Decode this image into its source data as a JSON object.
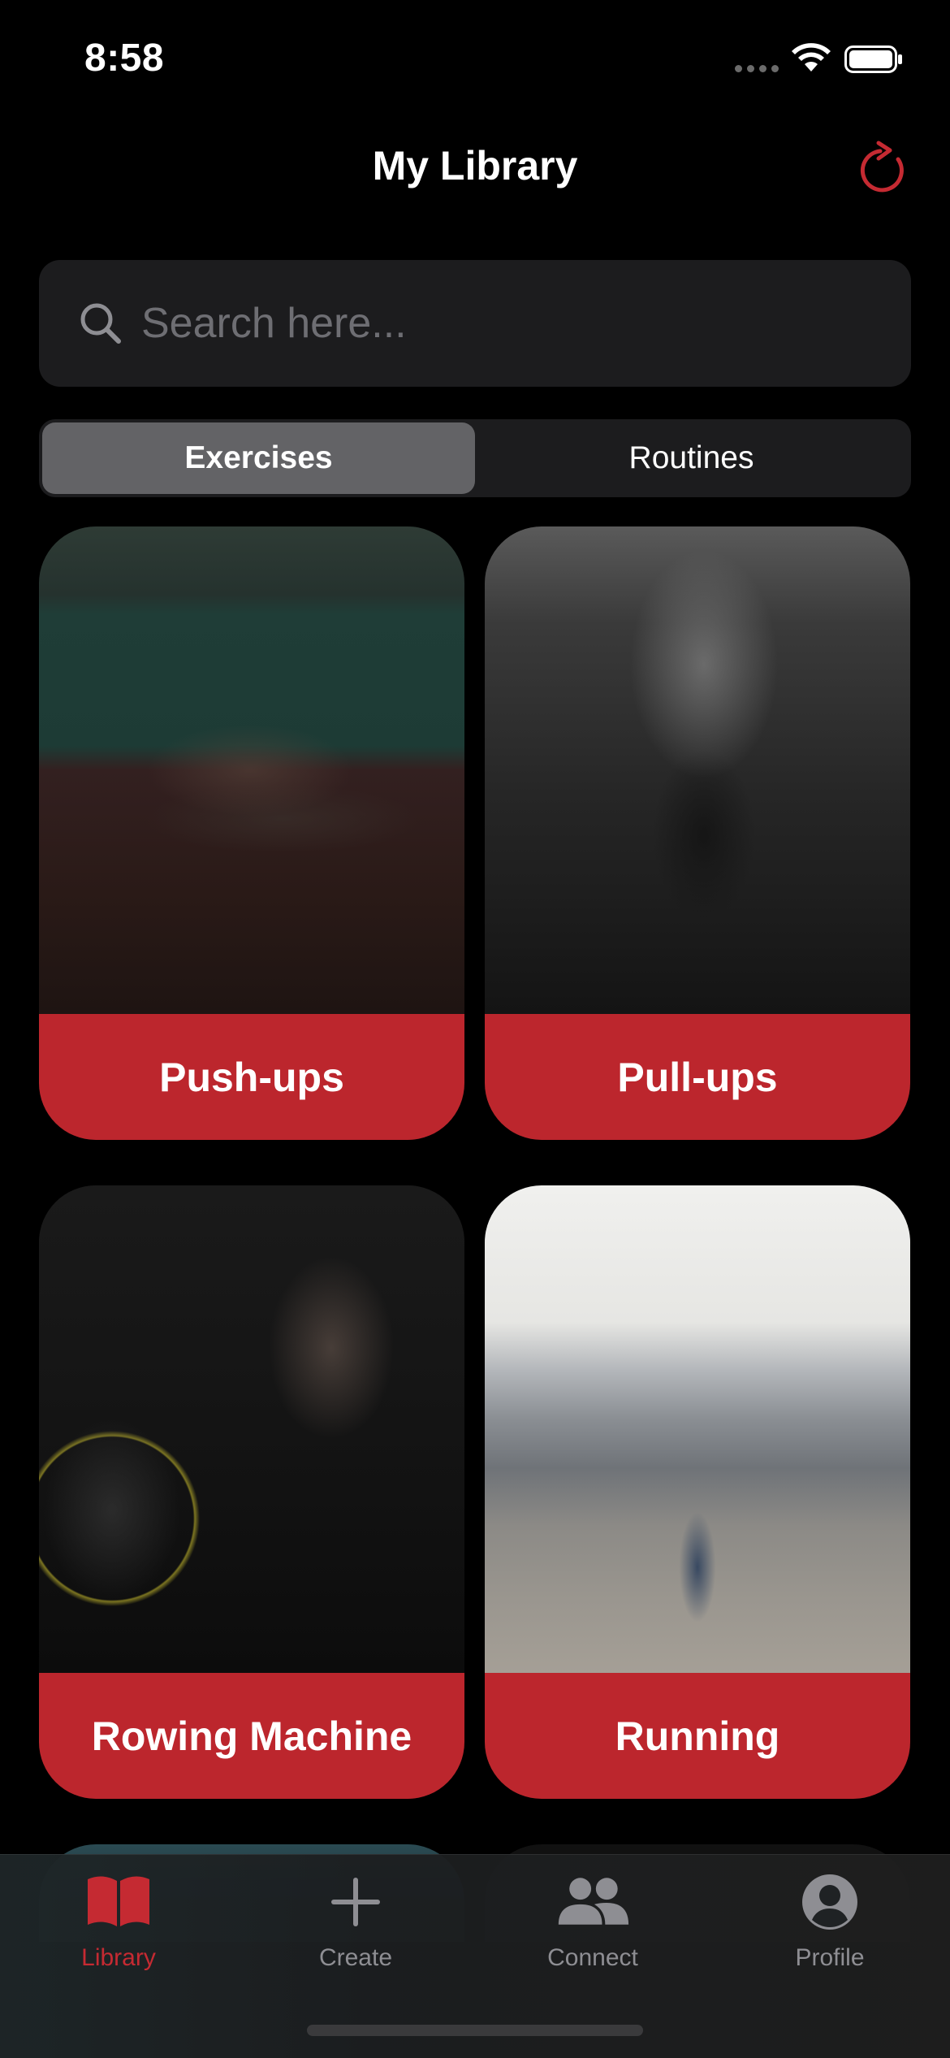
{
  "status_bar": {
    "time": "8:58"
  },
  "nav": {
    "title": "My Library"
  },
  "search": {
    "placeholder": "Search here...",
    "value": ""
  },
  "segments": [
    {
      "label": "Exercises",
      "selected": true
    },
    {
      "label": "Routines",
      "selected": false
    }
  ],
  "exercises": [
    {
      "name": "Push-ups"
    },
    {
      "name": "Pull-ups"
    },
    {
      "name": "Rowing Machine"
    },
    {
      "name": "Running"
    }
  ],
  "tab_bar": {
    "items": [
      {
        "label": "Library",
        "icon": "book-icon",
        "active": true
      },
      {
        "label": "Create",
        "icon": "plus-icon",
        "active": false
      },
      {
        "label": "Connect",
        "icon": "people-icon",
        "active": false
      },
      {
        "label": "Profile",
        "icon": "person-circle-icon",
        "active": false
      }
    ]
  },
  "colors": {
    "accent": "#bc262d",
    "tab_active": "#c52a32",
    "tab_inactive": "#8e8e93",
    "background": "#000000",
    "field": "#1c1c1e"
  }
}
